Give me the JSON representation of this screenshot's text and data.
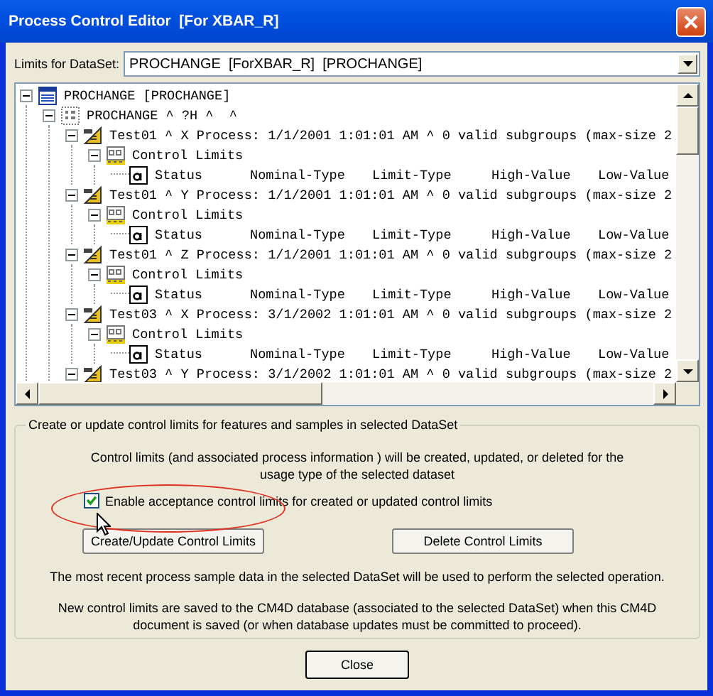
{
  "window": {
    "title": "Process Control Editor  [For XBAR_R]"
  },
  "dataset": {
    "label": "Limits for DataSet:",
    "value": "PROCHANGE  [ForXBAR_R]  [PROCHANGE]"
  },
  "tree": [
    {
      "kind": "dataset",
      "label": "PROCHANGE [PROCHANGE]",
      "expanded": true,
      "children": [
        {
          "kind": "group",
          "label": "PROCHANGE ^ ?H ^  ^",
          "expanded": true,
          "children": [
            {
              "kind": "feature",
              "label": "Test01 ^ X Process: 1/1/2001 1:01:01 AM ^ 0 valid subgroups (max-size 2",
              "expanded": true,
              "children": [
                {
                  "kind": "limits",
                  "label": "Control Limits",
                  "expanded": true,
                  "children": [
                    {
                      "kind": "status",
                      "columns": [
                        "Status",
                        "Nominal-Type",
                        "Limit-Type",
                        "High-Value",
                        "Low-Value"
                      ]
                    }
                  ]
                }
              ]
            },
            {
              "kind": "feature",
              "label": "Test01 ^ Y Process: 1/1/2001 1:01:01 AM ^ 0 valid subgroups (max-size 2",
              "expanded": true,
              "children": [
                {
                  "kind": "limits",
                  "label": "Control Limits",
                  "expanded": true,
                  "children": [
                    {
                      "kind": "status",
                      "columns": [
                        "Status",
                        "Nominal-Type",
                        "Limit-Type",
                        "High-Value",
                        "Low-Value"
                      ]
                    }
                  ]
                }
              ]
            },
            {
              "kind": "feature",
              "label": "Test01 ^ Z Process: 1/1/2001 1:01:01 AM ^ 0 valid subgroups (max-size 2",
              "expanded": true,
              "children": [
                {
                  "kind": "limits",
                  "label": "Control Limits",
                  "expanded": true,
                  "children": [
                    {
                      "kind": "status",
                      "columns": [
                        "Status",
                        "Nominal-Type",
                        "Limit-Type",
                        "High-Value",
                        "Low-Value"
                      ]
                    }
                  ]
                }
              ]
            },
            {
              "kind": "feature",
              "label": "Test03 ^ X Process: 3/1/2002 1:01:01 AM ^ 0 valid subgroups (max-size 2",
              "expanded": true,
              "children": [
                {
                  "kind": "limits",
                  "label": "Control Limits",
                  "expanded": true,
                  "children": [
                    {
                      "kind": "status",
                      "columns": [
                        "Status",
                        "Nominal-Type",
                        "Limit-Type",
                        "High-Value",
                        "Low-Value"
                      ]
                    }
                  ]
                }
              ]
            },
            {
              "kind": "feature",
              "label": "Test03 ^ Y Process: 3/1/2002 1:01:01 AM ^ 0 valid subgroups (max-size 2",
              "expanded": true
            }
          ]
        }
      ]
    }
  ],
  "groupbox": {
    "legend": "Create or update control limits for features and samples in selected DataSet",
    "description": "Control limits (and associated process information ) will be created, updated, or deleted for the usage type of the selected dataset",
    "checkbox": {
      "label": "Enable acceptance control limits for created or updated control limits",
      "checked": true
    },
    "buttons": [
      "Create/Update Control Limits",
      "Delete Control Limits"
    ],
    "notes": [
      "The most recent process sample data in the selected DataSet will be used to perform the selected operation.",
      "New control limits are saved to the CM4D database (associated to the selected DataSet) when this CM4D document is saved  (or when database updates must be committed to proceed)."
    ]
  },
  "close_button": "Close"
}
